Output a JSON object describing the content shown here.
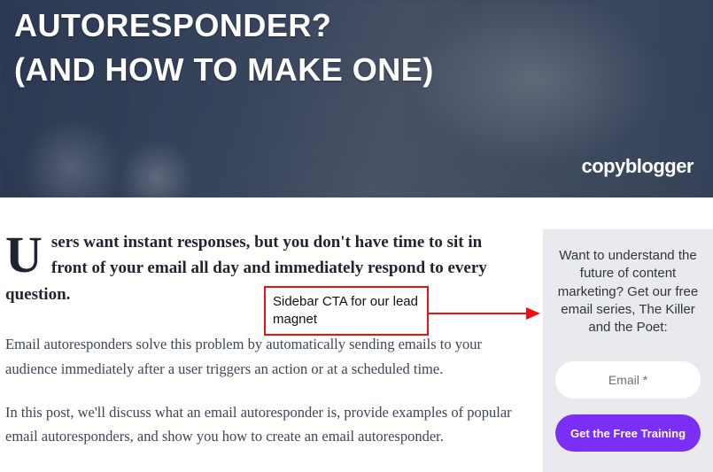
{
  "hero": {
    "title": "AUTORESPONDER?\n(AND HOW TO MAKE ONE)",
    "brand": "copyblogger"
  },
  "article": {
    "dropcap": "U",
    "lead": "sers want instant responses, but you don't have time to sit in front of your email all day and immediately respond to every question.",
    "p1": "Email autoresponders solve this problem by automatically sending emails to your audience immediately after a user triggers an action or at a scheduled time.",
    "p2": "In this post, we'll discuss what an email autoresponder is, provide examples of popular email autoresponders, and show you how to create an email autoresponder."
  },
  "sidebar": {
    "heading": "Want to understand the future of content marketing? Get our free email series, The Killer and the Poet:",
    "email_placeholder": "Email *",
    "cta_label": "Get the Free Training"
  },
  "annotation": {
    "label": "Sidebar CTA for our lead magnet"
  }
}
